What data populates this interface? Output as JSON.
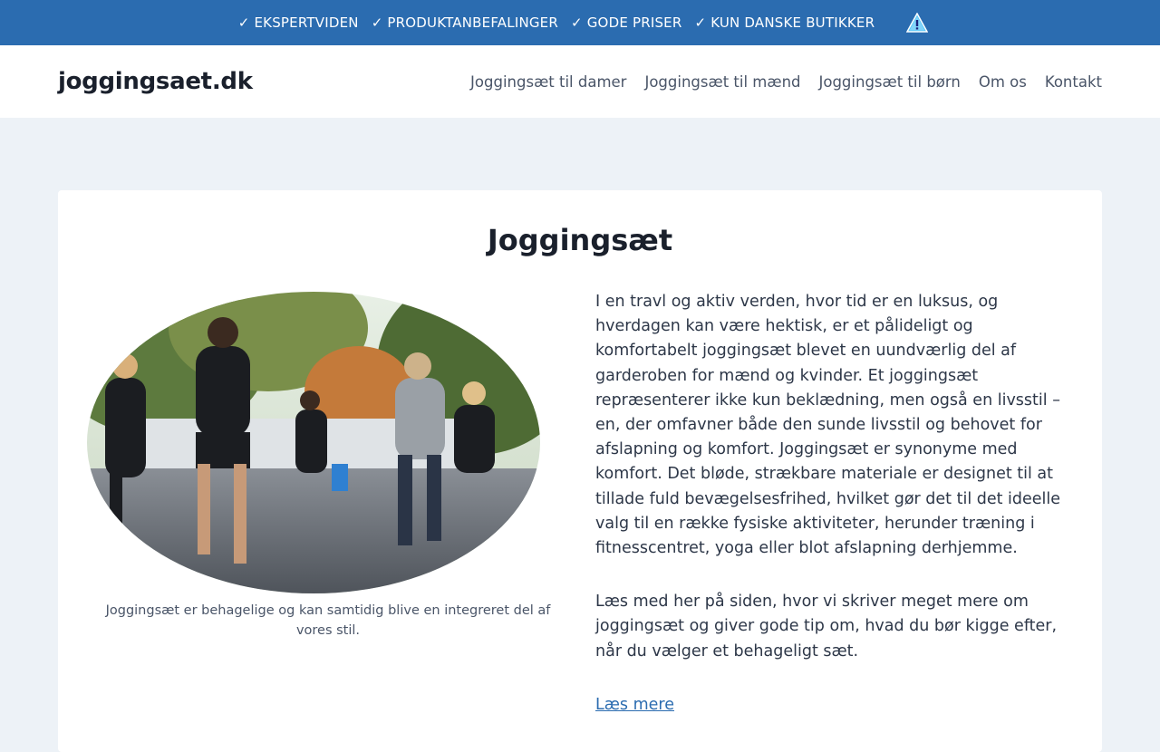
{
  "topbar": {
    "usps": [
      "✓ EKSPERTVIDEN",
      "✓ PRODUKTANBEFALINGER",
      "✓ GODE PRISER",
      "✓ KUN DANSKE BUTIKKER"
    ],
    "warning_icon": "warning-icon",
    "bg_color": "#2b6cb0"
  },
  "header": {
    "logo": "joggingsaet.dk",
    "nav": [
      "Joggingsæt til damer",
      "Joggingsæt til mænd",
      "Joggingsæt til børn",
      "Om os",
      "Kontakt"
    ]
  },
  "main": {
    "title": "Joggingsæt",
    "image_caption": "Joggingsæt er behagelige og kan samtidig blive en integreret del af vores stil.",
    "paragraphs": [
      "I en travl og aktiv verden, hvor tid er en luksus, og hverdagen kan være hektisk, er et pålideligt og komfortabelt joggingsæt blevet en uundværlig del af garderoben for mænd og kvinder. Et joggingsæt repræsenterer ikke kun beklædning, men også en livsstil – en, der omfavner både den sunde livsstil og behovet for afslapning og komfort. Joggingsæt er synonyme med komfort. Det bløde, strækbare materiale er designet til at tillade fuld bevægelsesfrihed, hvilket gør det til det ideelle valg til en række fysiske aktiviteter, herunder træning i fitnesscentret, yoga eller blot afslapning derhjemme.",
      "Læs med her på siden, hvor vi skriver meget mere om joggingsæt og giver gode tip om, hvad du bør kigge efter, når du vælger et behageligt sæt."
    ],
    "read_more": "Læs mere"
  }
}
